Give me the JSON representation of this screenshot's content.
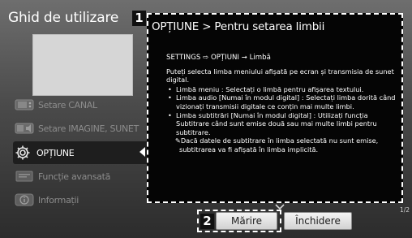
{
  "sidebar": {
    "title": "Ghid de utilizare",
    "items": [
      {
        "label": "Setare CANAL",
        "icon": "channel-icon",
        "active": false
      },
      {
        "label": "Setare IMAGINE, SUNET",
        "icon": "picture-sound-icon",
        "active": false
      },
      {
        "label": "OPȚIUNE",
        "icon": "gear-icon",
        "active": true
      },
      {
        "label": "Funcție avansată",
        "icon": "advanced-function-icon",
        "active": false
      },
      {
        "label": "Informații",
        "icon": "info-icon",
        "active": false
      }
    ]
  },
  "badges": {
    "panel": "1",
    "buttons": "2"
  },
  "panel": {
    "title": "OPȚIUNE > Pentru setarea limbii",
    "path": "SETTINGS ⇨ OPȚIUNI ➞ Limbă",
    "intro": "Puteți selecta limba meniului afișată pe ecran și transmisia de sunet digital.",
    "bullets": [
      "Limbă meniu : Selectați o limbă pentru afișarea textului.",
      "Limba audio [Numai în modul digital] : Selectați limba dorită când vizionați transmisii digitale ce conțin mai multe limbi.",
      "Limba subtitrări [Numai în modul digital] : Utilizați funcția Subtitrare când sunt emise două sau mai multe limbi pentru subtitrare."
    ],
    "note": "✎Dacă datele de subtitrare în limba selectată nu sunt emise, subtitrarea va fi afișată în limba implicită.",
    "page": "1/2"
  },
  "buttons": {
    "zoom_label": "Mărire",
    "close_label": "Închidere"
  },
  "colors": {
    "panel_bg": "#050505",
    "active_item_bg": "#1e1e1e",
    "button_bg": "#e6e6e6"
  }
}
